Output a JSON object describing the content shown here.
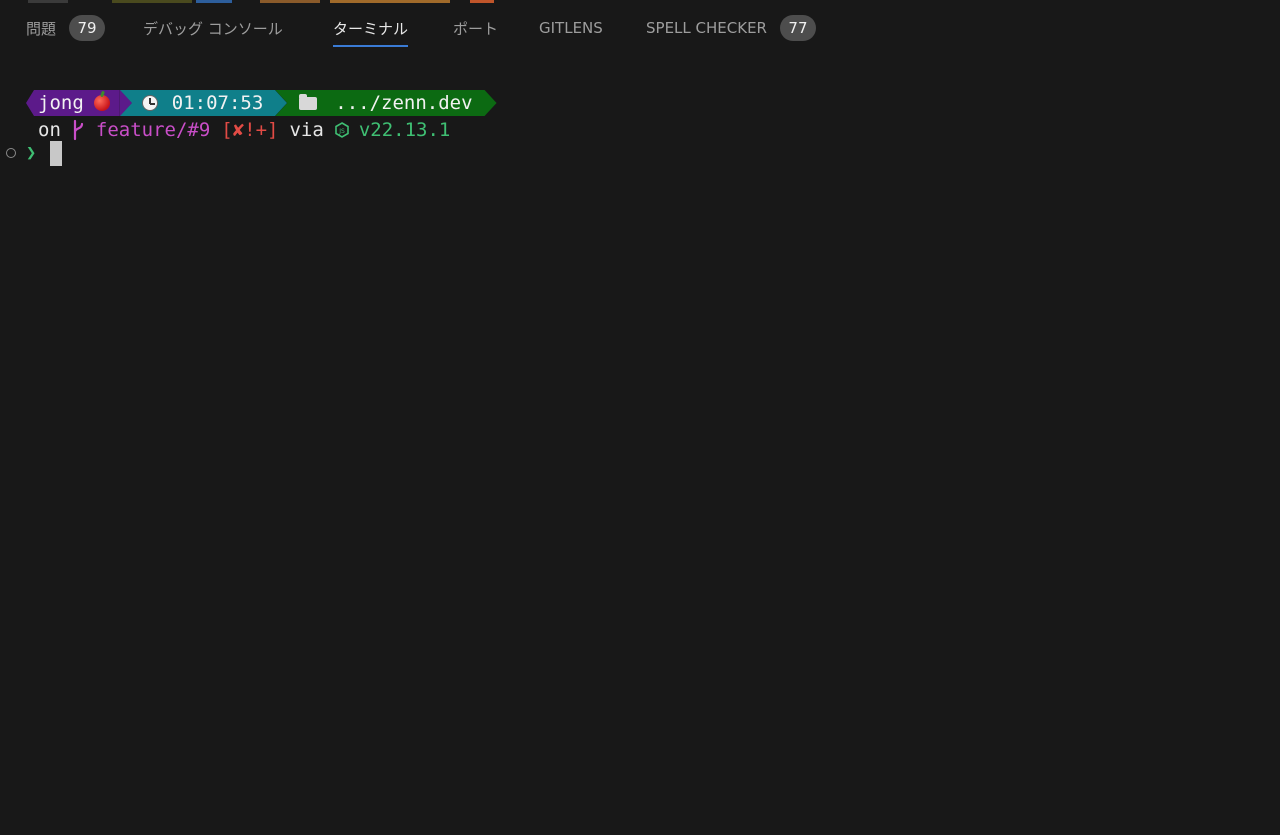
{
  "panel": {
    "tabs": [
      {
        "label": "問題",
        "badge": "79"
      },
      {
        "label": "デバッグ コンソール"
      },
      {
        "label": "ターミナル",
        "active": true
      },
      {
        "label": "ポート"
      },
      {
        "label": "GITLENS"
      },
      {
        "label": "SPELL CHECKER",
        "badge": "77"
      }
    ]
  },
  "terminal": {
    "prompt": {
      "user": "jong",
      "user_icon": "apple-icon",
      "time_icon": "clock-icon",
      "time": "01:07:53",
      "dir_icon": "folder-icon",
      "directory": ".../zenn.dev"
    },
    "git_line": {
      "on": "on",
      "branch_icon": "git-branch-icon",
      "branch": "feature/#9",
      "status": "[✘!+]",
      "via": "via",
      "runtime_icon": "nodejs-icon",
      "node_version": "v22.13.1"
    },
    "input": {
      "prompt_char": "❯",
      "value": ""
    }
  },
  "colors": {
    "background": "#181818",
    "active_tab_underline": "#3a7bd5",
    "user_segment": "#5c1a8a",
    "time_segment": "#0f7f8a",
    "dir_segment": "#0c6a12",
    "branch": "#c94ec8",
    "git_status": "#e24b45",
    "node_version": "#3fbf73"
  }
}
